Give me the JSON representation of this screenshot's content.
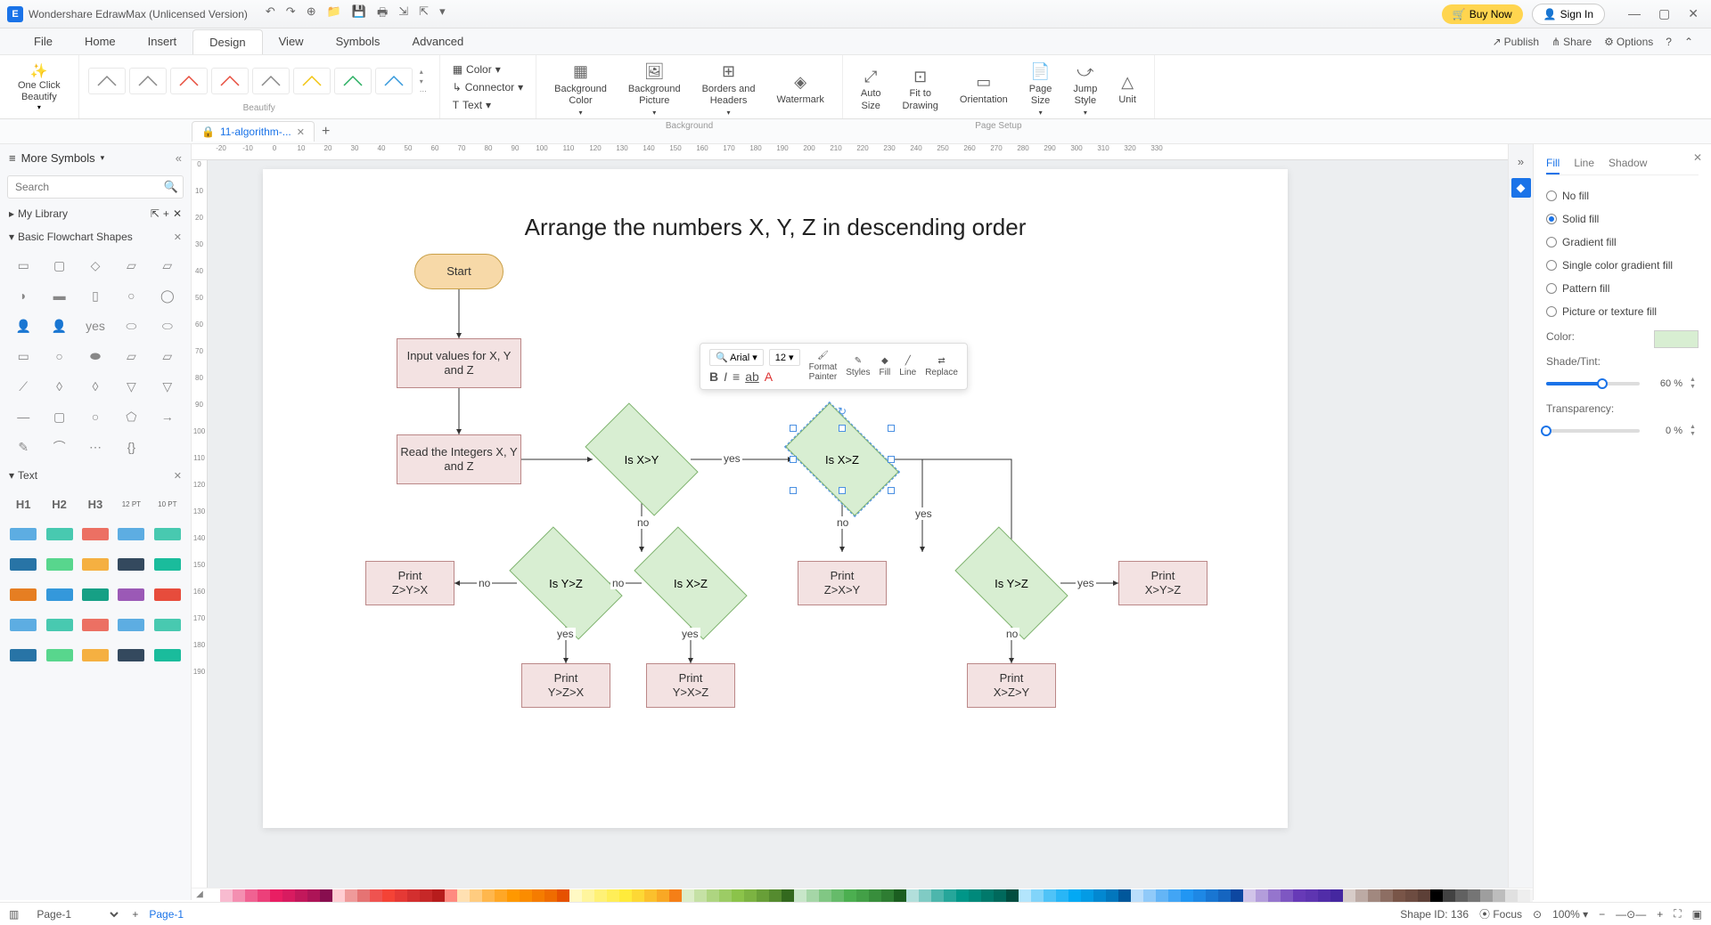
{
  "title": "Wondershare EdrawMax (Unlicensed Version)",
  "titlebar_buttons": {
    "buy": "Buy Now",
    "signin": "Sign In"
  },
  "menubar": {
    "items": [
      "File",
      "Home",
      "Insert",
      "Design",
      "View",
      "Symbols",
      "Advanced"
    ],
    "active": 3,
    "right": {
      "publish": "Publish",
      "share": "Share",
      "options": "Options"
    }
  },
  "ribbon": {
    "one_click": "One Click\nBeautify",
    "beautify_label": "Beautify",
    "color": "Color",
    "connector": "Connector",
    "text": "Text",
    "bg_color": "Background\nColor",
    "bg_pic": "Background\nPicture",
    "borders": "Borders and\nHeaders",
    "watermark": "Watermark",
    "background_label": "Background",
    "auto_size": "Auto\nSize",
    "fit": "Fit to\nDrawing",
    "orientation": "Orientation",
    "page_size": "Page\nSize",
    "jump_style": "Jump\nStyle",
    "unit": "Unit",
    "page_setup_label": "Page Setup"
  },
  "tab": {
    "name": "11-algorithm-..."
  },
  "sidebar": {
    "header": "More Symbols",
    "search_placeholder": "Search",
    "my_library": "My Library",
    "flowchart_section": "Basic Flowchart Shapes",
    "text_section": "Text",
    "text_items": [
      "H1",
      "H2",
      "H3",
      "12 PT",
      "10 PT"
    ]
  },
  "ruler_h": [
    -20,
    -10,
    0,
    10,
    20,
    30,
    40,
    50,
    60,
    70,
    80,
    90,
    100,
    110,
    120,
    130,
    140,
    150,
    160,
    170,
    180,
    190,
    200,
    210,
    220,
    230,
    240,
    250,
    260,
    270,
    280,
    290,
    300,
    310,
    320,
    330
  ],
  "ruler_v": [
    0,
    10,
    20,
    30,
    40,
    50,
    60,
    70,
    80,
    90,
    100,
    110,
    120,
    130,
    140,
    150,
    160,
    170,
    180,
    190
  ],
  "flowchart": {
    "title": "Arrange the numbers X, Y, Z in descending order",
    "start": "Start",
    "input": "Input values for X, Y and Z",
    "read": "Read the Integers X, Y and Z",
    "d1": "Is X>Y",
    "d2": "Is X>Z",
    "d3": "Is Y>Z",
    "d4": "Is X>Z",
    "d5": "Is Y>Z",
    "p1": "Print\nZ>Y>X",
    "p2": "Print\nZ>X>Y",
    "p3": "Print\nX>Y>Z",
    "p4": "Print\nY>Z>X",
    "p5": "Print\nY>X>Z",
    "p6": "Print\nX>Z>Y",
    "yes": "yes",
    "no": "no"
  },
  "float_toolbar": {
    "font": "Arial",
    "size": "12",
    "format_painter": "Format\nPainter",
    "styles": "Styles",
    "fill": "Fill",
    "line": "Line",
    "replace": "Replace"
  },
  "right_panel": {
    "tabs": [
      "Fill",
      "Line",
      "Shadow"
    ],
    "active": 0,
    "options": [
      "No fill",
      "Solid fill",
      "Gradient fill",
      "Single color gradient fill",
      "Pattern fill",
      "Picture or texture fill"
    ],
    "checked": 1,
    "color_label": "Color:",
    "shade_label": "Shade/Tint:",
    "shade_val": "60 %",
    "transparency_label": "Transparency:",
    "transparency_val": "0 %"
  },
  "statusbar": {
    "page": "Page-1",
    "page_link": "Page-1",
    "shape_id": "Shape ID: 136",
    "focus": "Focus",
    "zoom": "100%"
  },
  "colors": [
    "#ffffff",
    "#f8bbd0",
    "#f48fb1",
    "#f06292",
    "#ec407a",
    "#e91e63",
    "#d81b60",
    "#c2185b",
    "#ad1457",
    "#880e4f",
    "#ffcdd2",
    "#ef9a9a",
    "#e57373",
    "#ef5350",
    "#f44336",
    "#e53935",
    "#d32f2f",
    "#c62828",
    "#b71c1c",
    "#ff8a80",
    "#ffe0b2",
    "#ffcc80",
    "#ffb74d",
    "#ffa726",
    "#ff9800",
    "#fb8c00",
    "#f57c00",
    "#ef6c00",
    "#e65100",
    "#fff9c4",
    "#fff59d",
    "#fff176",
    "#ffee58",
    "#ffeb3b",
    "#fdd835",
    "#fbc02d",
    "#f9a825",
    "#f57f17",
    "#dcedc8",
    "#c5e1a5",
    "#aed581",
    "#9ccc65",
    "#8bc34a",
    "#7cb342",
    "#689f38",
    "#558b2f",
    "#33691e",
    "#c8e6c9",
    "#a5d6a7",
    "#81c784",
    "#66bb6a",
    "#4caf50",
    "#43a047",
    "#388e3c",
    "#2e7d32",
    "#1b5e20",
    "#b2dfdb",
    "#80cbc4",
    "#4db6ac",
    "#26a69a",
    "#009688",
    "#00897b",
    "#00796b",
    "#00695c",
    "#004d40",
    "#b3e5fc",
    "#81d4fa",
    "#4fc3f7",
    "#29b6f6",
    "#03a9f4",
    "#039be5",
    "#0288d1",
    "#0277bd",
    "#01579b",
    "#bbdefb",
    "#90caf9",
    "#64b5f6",
    "#42a5f5",
    "#2196f3",
    "#1e88e5",
    "#1976d2",
    "#1565c0",
    "#0d47a1",
    "#d1c4e9",
    "#b39ddb",
    "#9575cd",
    "#7e57c2",
    "#673ab7",
    "#5e35b1",
    "#512da8",
    "#4527a0",
    "#d7ccc8",
    "#bcaaa4",
    "#a1887f",
    "#8d6e63",
    "#795548",
    "#6d4c41",
    "#5d4037",
    "#000000",
    "#424242",
    "#616161",
    "#757575",
    "#9e9e9e",
    "#bdbdbd",
    "#e0e0e0",
    "#eeeeee",
    "#f5f5f5"
  ]
}
